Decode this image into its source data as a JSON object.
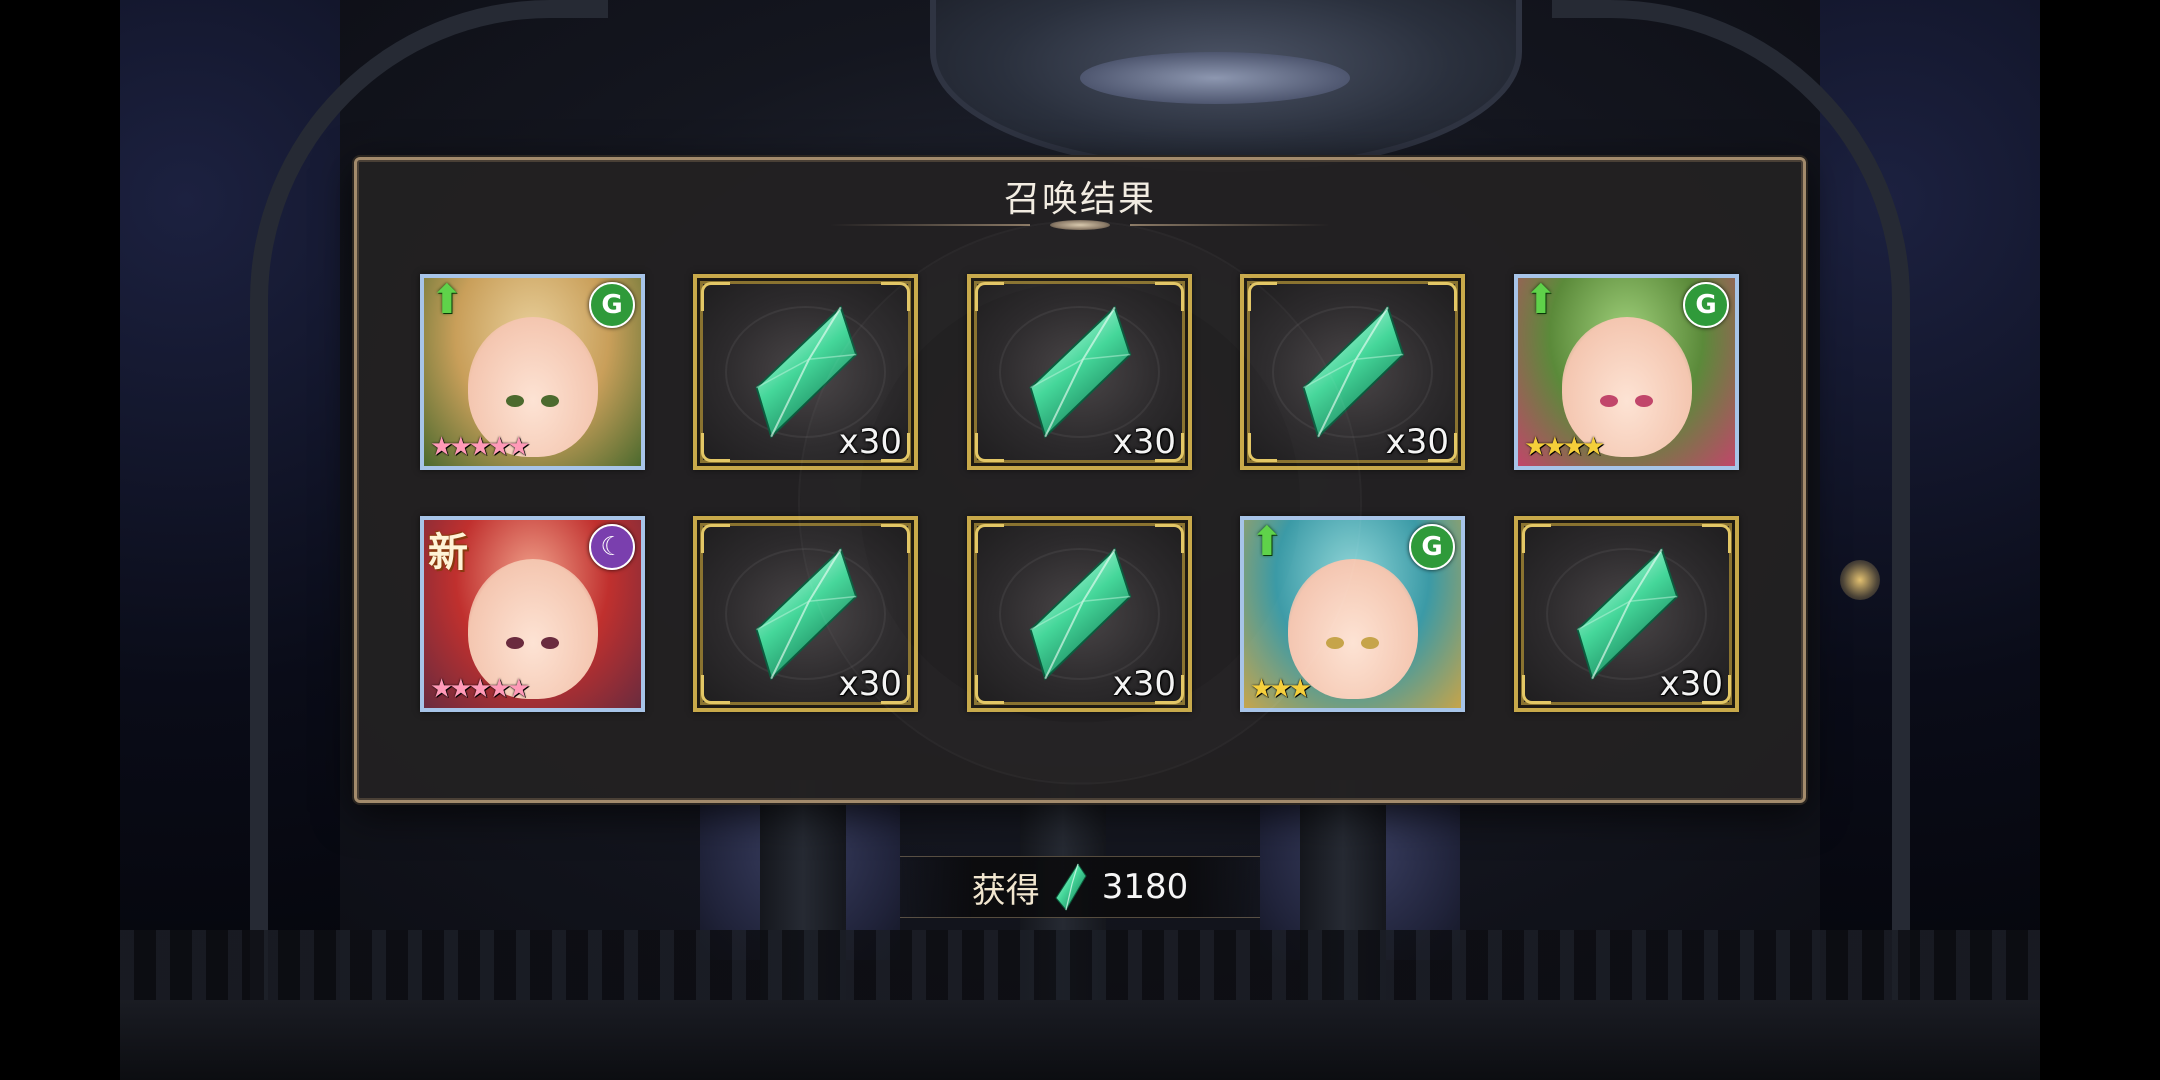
{
  "panel": {
    "title": "召唤结果"
  },
  "results": [
    {
      "type": "hero",
      "stars": "★★★★★",
      "star_color": "#ff9ab8",
      "element": "wind",
      "element_glyph": "G",
      "element_color": "#2f9a3a",
      "up": true,
      "new": false,
      "palette": [
        "#e8cf9a",
        "#c99f5a",
        "#4c6a2e"
      ]
    },
    {
      "type": "item",
      "item": "green-crystal",
      "quantity": "x30"
    },
    {
      "type": "item",
      "item": "green-crystal",
      "quantity": "x30"
    },
    {
      "type": "item",
      "item": "green-crystal",
      "quantity": "x30"
    },
    {
      "type": "hero",
      "stars": "★★★★",
      "star_color": "#f5cf3a",
      "element": "wind",
      "element_glyph": "G",
      "element_color": "#2f9a3a",
      "up": true,
      "new": false,
      "palette": [
        "#9fcf7a",
        "#5b8a3a",
        "#c1466a"
      ]
    },
    {
      "type": "hero",
      "stars": "★★★★★",
      "star_color": "#ff9ab8",
      "element": "dark",
      "element_glyph": "☾",
      "element_color": "#7a3fae",
      "up": false,
      "new": true,
      "new_label": "新",
      "palette": [
        "#f0a08a",
        "#c0302e",
        "#6a2b3e"
      ]
    },
    {
      "type": "item",
      "item": "green-crystal",
      "quantity": "x30"
    },
    {
      "type": "item",
      "item": "green-crystal",
      "quantity": "x30"
    },
    {
      "type": "hero",
      "stars": "★★★",
      "star_color": "#f5cf3a",
      "element": "wind",
      "element_glyph": "G",
      "element_color": "#2f9a3a",
      "up": true,
      "new": false,
      "palette": [
        "#8fd6d8",
        "#3b9aa6",
        "#c6a44a"
      ]
    },
    {
      "type": "item",
      "item": "green-crystal",
      "quantity": "x30"
    }
  ],
  "obtain": {
    "label": "获得",
    "icon": "green-crystal-icon",
    "value": "3180"
  }
}
